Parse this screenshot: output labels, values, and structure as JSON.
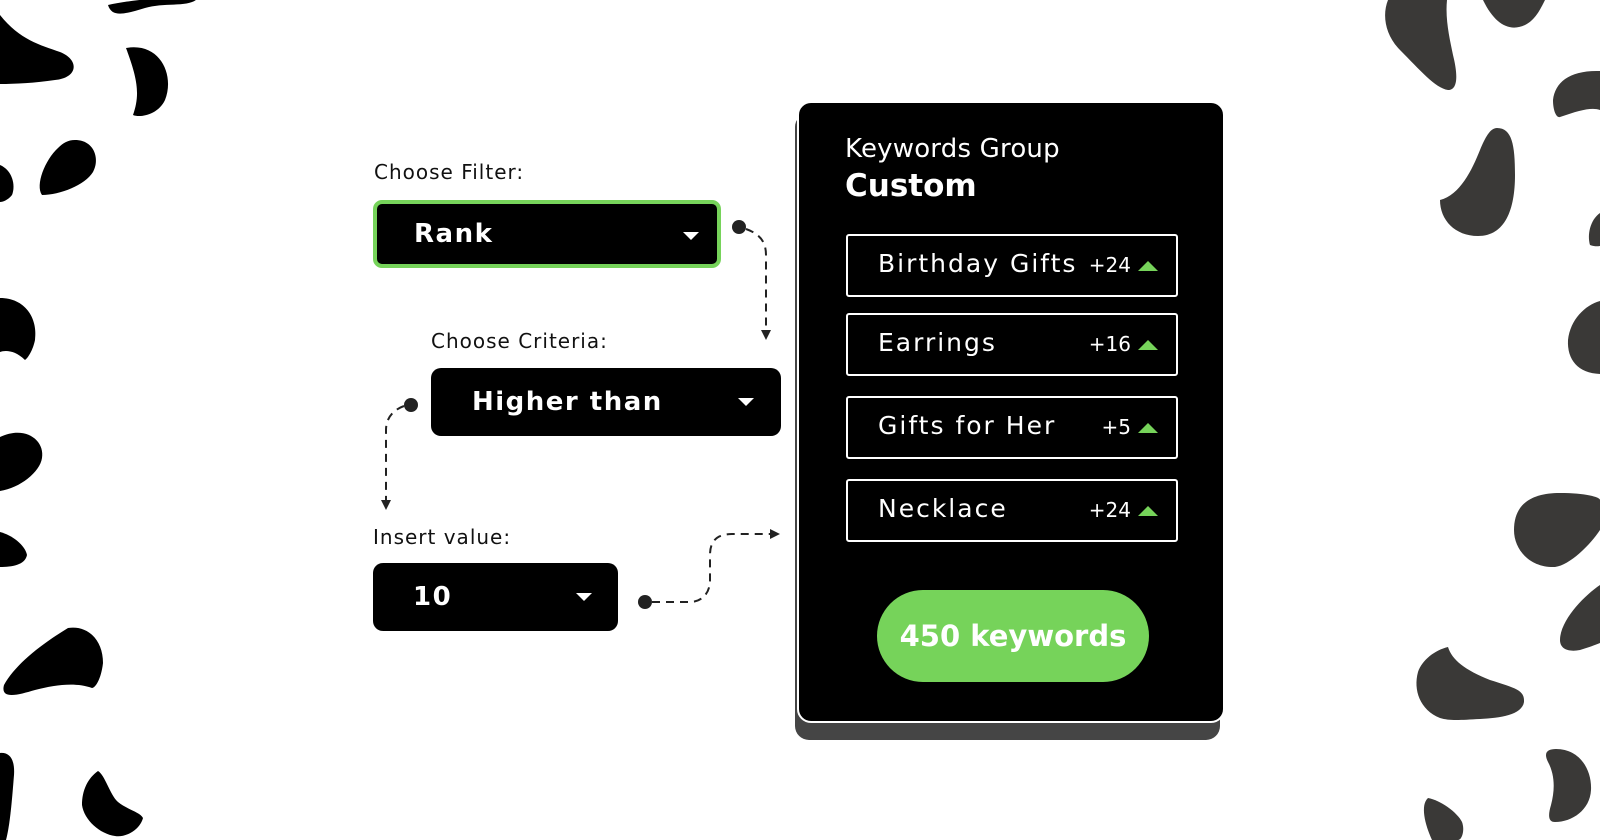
{
  "filters": {
    "filter": {
      "label": "Choose Filter:",
      "value": "Rank"
    },
    "criteria": {
      "label": "Choose Criteria:",
      "value": "Higher than"
    },
    "value": {
      "label": "Insert value:",
      "value": "10"
    }
  },
  "card": {
    "subtitle": "Keywords Group",
    "title": "Custom",
    "keywords": [
      {
        "name": "Birthday Gifts",
        "delta": "+24",
        "trend": "up"
      },
      {
        "name": "Earrings",
        "delta": "+16",
        "trend": "up"
      },
      {
        "name": "Gifts for Her",
        "delta": "+5",
        "trend": "up"
      },
      {
        "name": "Necklace",
        "delta": "+24",
        "trend": "up"
      }
    ],
    "count_label": "450 keywords"
  },
  "colors": {
    "accent": "#76d35a",
    "dark": "#000000",
    "shadow": "#454545",
    "blob_left": "#000000",
    "blob_right": "#3a3937"
  }
}
